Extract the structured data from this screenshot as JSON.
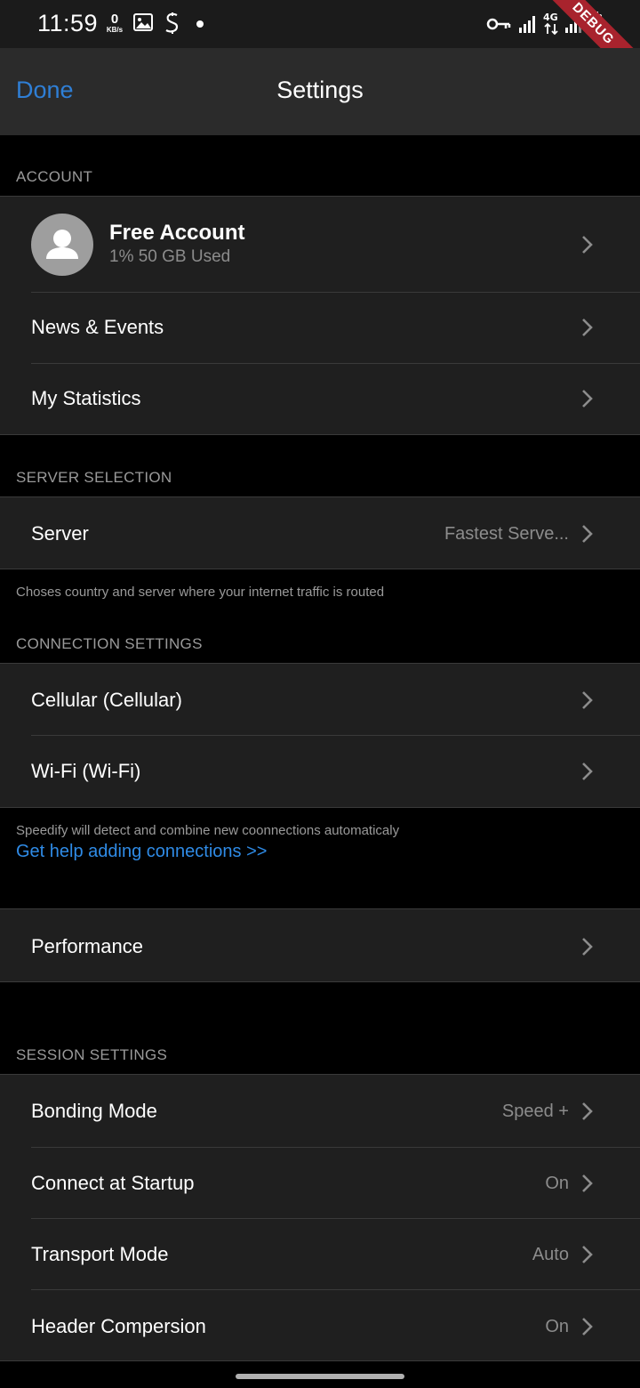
{
  "status_bar": {
    "time": "11:59",
    "net_speed_value": "0",
    "net_speed_unit": "KB/s",
    "debug_label": "DEBUG",
    "left_icons": [
      "image-icon",
      "speedify-icon",
      "notification-dot-icon"
    ],
    "right_icons": [
      "vpn-key-icon",
      "signal-icon",
      "4g-data-icon",
      "signal-icon",
      "battery-icon"
    ]
  },
  "nav": {
    "done_label": "Done",
    "title": "Settings",
    "accent_color": "#2f7fd6"
  },
  "account_section": {
    "header": "ACCOUNT",
    "account": {
      "title": "Free Account",
      "subtitle": "1% 50 GB Used",
      "avatar_icon": "person-icon"
    },
    "items": [
      {
        "label": "News & Events"
      },
      {
        "label": "My Statistics"
      }
    ]
  },
  "server_section": {
    "header": "SERVER SELECTION",
    "server_label": "Server",
    "server_value": "Fastest Serve...",
    "footer": "Choses country and server where your internet traffic is routed"
  },
  "connection_section": {
    "header": "CONNECTION SETTINGS",
    "items": [
      {
        "label": "Cellular (Cellular)"
      },
      {
        "label": "Wi-Fi (Wi-Fi)"
      }
    ],
    "footer": "Speedify will detect and combine new coonnections automaticaly",
    "help_link": "Get help adding connections >>"
  },
  "performance_section": {
    "label": "Performance"
  },
  "session_section": {
    "header": "SESSION SETTINGS",
    "items": [
      {
        "label": "Bonding Mode",
        "value": "Speed +"
      },
      {
        "label": "Connect at Startup",
        "value": "On"
      },
      {
        "label": "Transport Mode",
        "value": "Auto"
      },
      {
        "label": "Header Compersion",
        "value": "On"
      }
    ]
  }
}
